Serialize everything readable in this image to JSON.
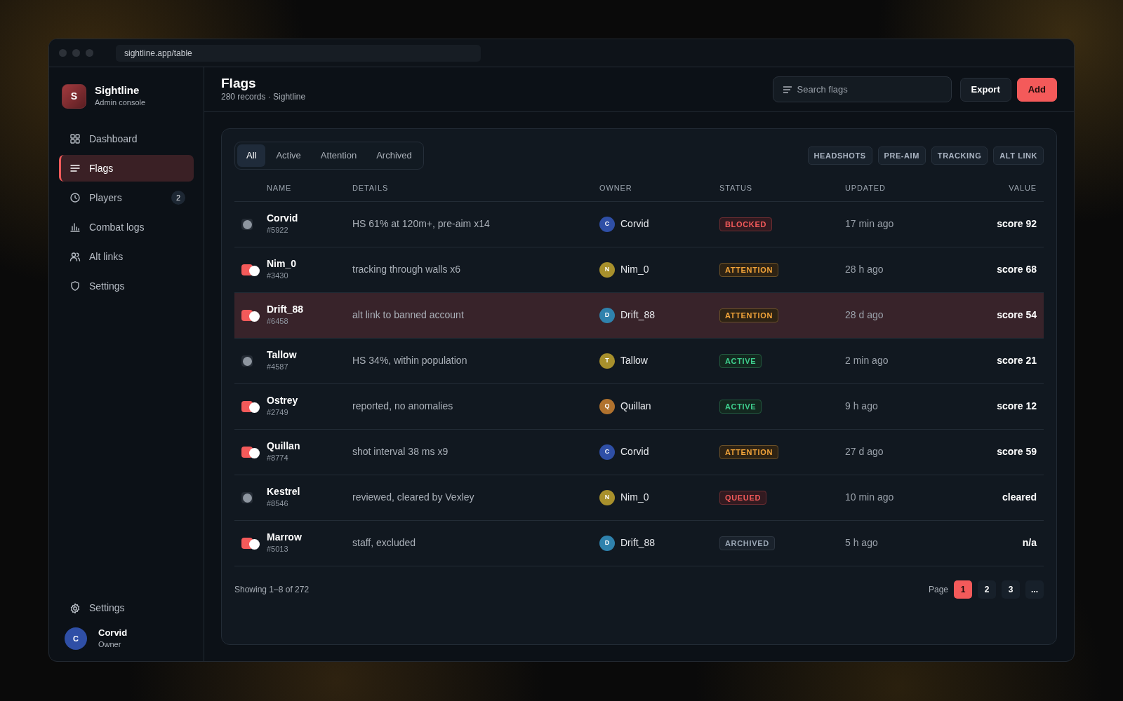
{
  "browser": {
    "url": "sightline.app/table"
  },
  "sidebar": {
    "brand": {
      "initial": "S",
      "name": "Sightline",
      "subtitle": "Admin console"
    },
    "nav": [
      {
        "label": "Dashboard",
        "selected": false
      },
      {
        "label": "Flags",
        "selected": true
      },
      {
        "label": "Players",
        "selected": false,
        "badge": "2"
      },
      {
        "label": "Combat logs",
        "selected": false
      },
      {
        "label": "Alt links",
        "selected": false
      },
      {
        "label": "Settings",
        "selected": false
      }
    ],
    "footer_link": {
      "label": "Settings"
    },
    "user": {
      "initial": "C",
      "name": "Corvid",
      "role": "Owner",
      "color": "#2f4fa6"
    }
  },
  "header": {
    "title": "Flags",
    "subtitle": "280 records · Sightline",
    "search": {
      "placeholder": "Search flags"
    },
    "buttons": [
      {
        "label": "Export",
        "kind": "secondary"
      },
      {
        "label": "Add",
        "kind": "primary"
      }
    ]
  },
  "filters": {
    "tabs": [
      {
        "label": "All",
        "selected": true
      },
      {
        "label": "Active",
        "selected": false
      },
      {
        "label": "Attention",
        "selected": false
      },
      {
        "label": "Archived",
        "selected": false
      }
    ],
    "tags": [
      "HEADSHOTS",
      "PRE-AIM",
      "TRACKING",
      "ALT LINK"
    ]
  },
  "table": {
    "columns": [
      "NAME",
      "DETAILS",
      "OWNER",
      "STATUS",
      "UPDATED",
      "VALUE"
    ],
    "rows": [
      {
        "on": false,
        "selected": false,
        "name": "Corvid",
        "id": "#5922",
        "details": "HS 61% at 120m+, pre-aim x14",
        "owner": {
          "initial": "C",
          "name": "Corvid",
          "color": "#2f4fa6"
        },
        "status": {
          "label": "BLOCKED",
          "kind": "danger"
        },
        "updated": "17 min ago",
        "value": "score 92"
      },
      {
        "on": true,
        "selected": false,
        "name": "Nim_0",
        "id": "#3430",
        "details": "tracking through walls x6",
        "owner": {
          "initial": "N",
          "name": "Nim_0",
          "color": "#a8902c"
        },
        "status": {
          "label": "ATTENTION",
          "kind": "warning"
        },
        "updated": "28 h ago",
        "value": "score 68"
      },
      {
        "on": true,
        "selected": true,
        "name": "Drift_88",
        "id": "#6458",
        "details": "alt link to banned account",
        "owner": {
          "initial": "D",
          "name": "Drift_88",
          "color": "#2f82ad"
        },
        "status": {
          "label": "ATTENTION",
          "kind": "warning"
        },
        "updated": "28 d ago",
        "value": "score 54"
      },
      {
        "on": false,
        "selected": false,
        "name": "Tallow",
        "id": "#4587",
        "details": "HS 34%, within population",
        "owner": {
          "initial": "T",
          "name": "Tallow",
          "color": "#a8902c"
        },
        "status": {
          "label": "ACTIVE",
          "kind": "success"
        },
        "updated": "2 min ago",
        "value": "score 21"
      },
      {
        "on": true,
        "selected": false,
        "name": "Ostrey",
        "id": "#2749",
        "details": "reported, no anomalies",
        "owner": {
          "initial": "Q",
          "name": "Quillan",
          "color": "#b0722e"
        },
        "status": {
          "label": "ACTIVE",
          "kind": "success"
        },
        "updated": "9 h ago",
        "value": "score 12"
      },
      {
        "on": true,
        "selected": false,
        "name": "Quillan",
        "id": "#8774",
        "details": "shot interval 38 ms x9",
        "owner": {
          "initial": "C",
          "name": "Corvid",
          "color": "#2f4fa6"
        },
        "status": {
          "label": "ATTENTION",
          "kind": "warning"
        },
        "updated": "27 d ago",
        "value": "score 59"
      },
      {
        "on": false,
        "selected": false,
        "name": "Kestrel",
        "id": "#8546",
        "details": "reviewed, cleared by Vexley",
        "owner": {
          "initial": "N",
          "name": "Nim_0",
          "color": "#a8902c"
        },
        "status": {
          "label": "QUEUED",
          "kind": "danger"
        },
        "updated": "10 min ago",
        "value": "cleared"
      },
      {
        "on": true,
        "selected": false,
        "name": "Marrow",
        "id": "#5013",
        "details": "staff, excluded",
        "owner": {
          "initial": "D",
          "name": "Drift_88",
          "color": "#2f82ad"
        },
        "status": {
          "label": "ARCHIVED",
          "kind": "muted"
        },
        "updated": "5 h ago",
        "value": "n/a"
      }
    ]
  },
  "footer": {
    "summary": "Showing 1–8 of 272",
    "page_label": "Page",
    "pages": [
      {
        "label": "1",
        "selected": true
      },
      {
        "label": "2",
        "selected": false
      },
      {
        "label": "3",
        "selected": false
      },
      {
        "label": "...",
        "selected": false
      }
    ]
  }
}
